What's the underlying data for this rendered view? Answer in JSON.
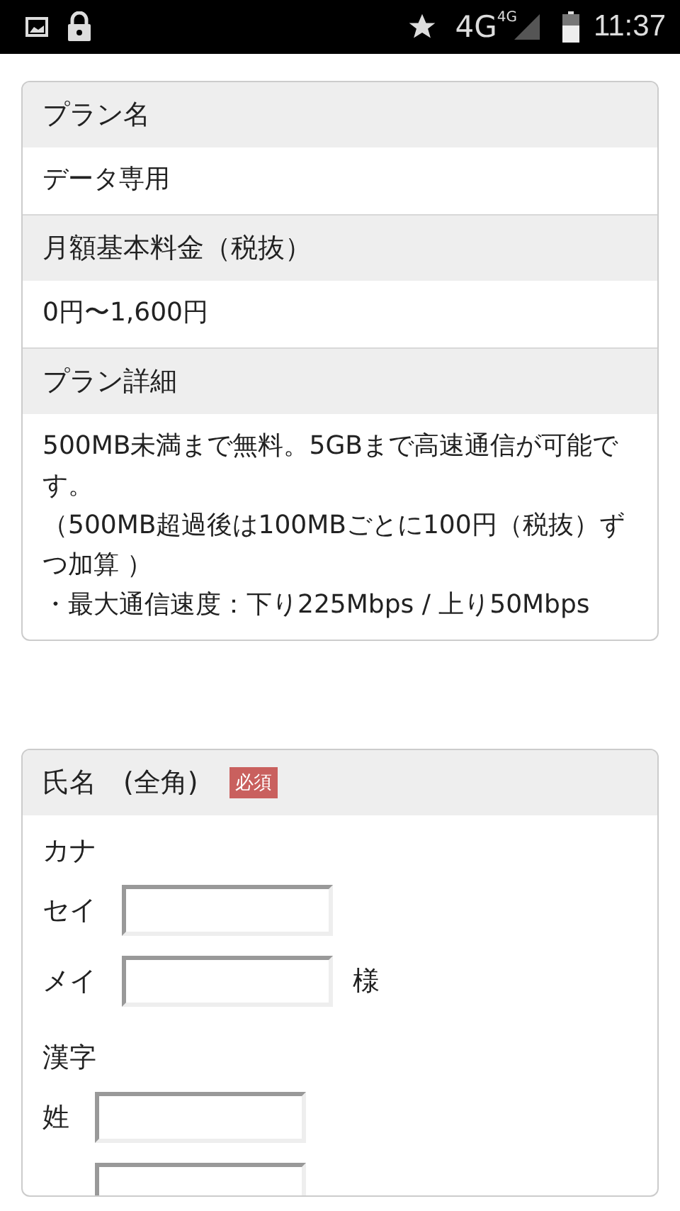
{
  "status_bar": {
    "time": "11:37",
    "network": "4G",
    "network_small": "4G"
  },
  "plan": [
    {
      "label": "プラン名",
      "value": [
        "データ専用"
      ]
    },
    {
      "label": "月額基本料金（税抜）",
      "value": [
        "0円〜1,600円"
      ]
    },
    {
      "label": "プラン詳細",
      "value": [
        "500MB未満まで無料。5GBまで高速通信が可能です。",
        "（500MB超過後は100MBごとに100円（税抜）ずつ加算 ）",
        "・最大通信速度：下り225Mbps / 上り50Mbps"
      ]
    }
  ],
  "name_form": {
    "label": "氏名　(全角)",
    "required": "必須",
    "groups": [
      {
        "label": "カナ",
        "rows": [
          {
            "label": "セイ",
            "suffix": ""
          },
          {
            "label": "メイ",
            "suffix": "様"
          }
        ]
      },
      {
        "label": "漢字",
        "rows": [
          {
            "label": "姓",
            "suffix": ""
          },
          {
            "label": "",
            "suffix": ""
          }
        ]
      }
    ]
  }
}
